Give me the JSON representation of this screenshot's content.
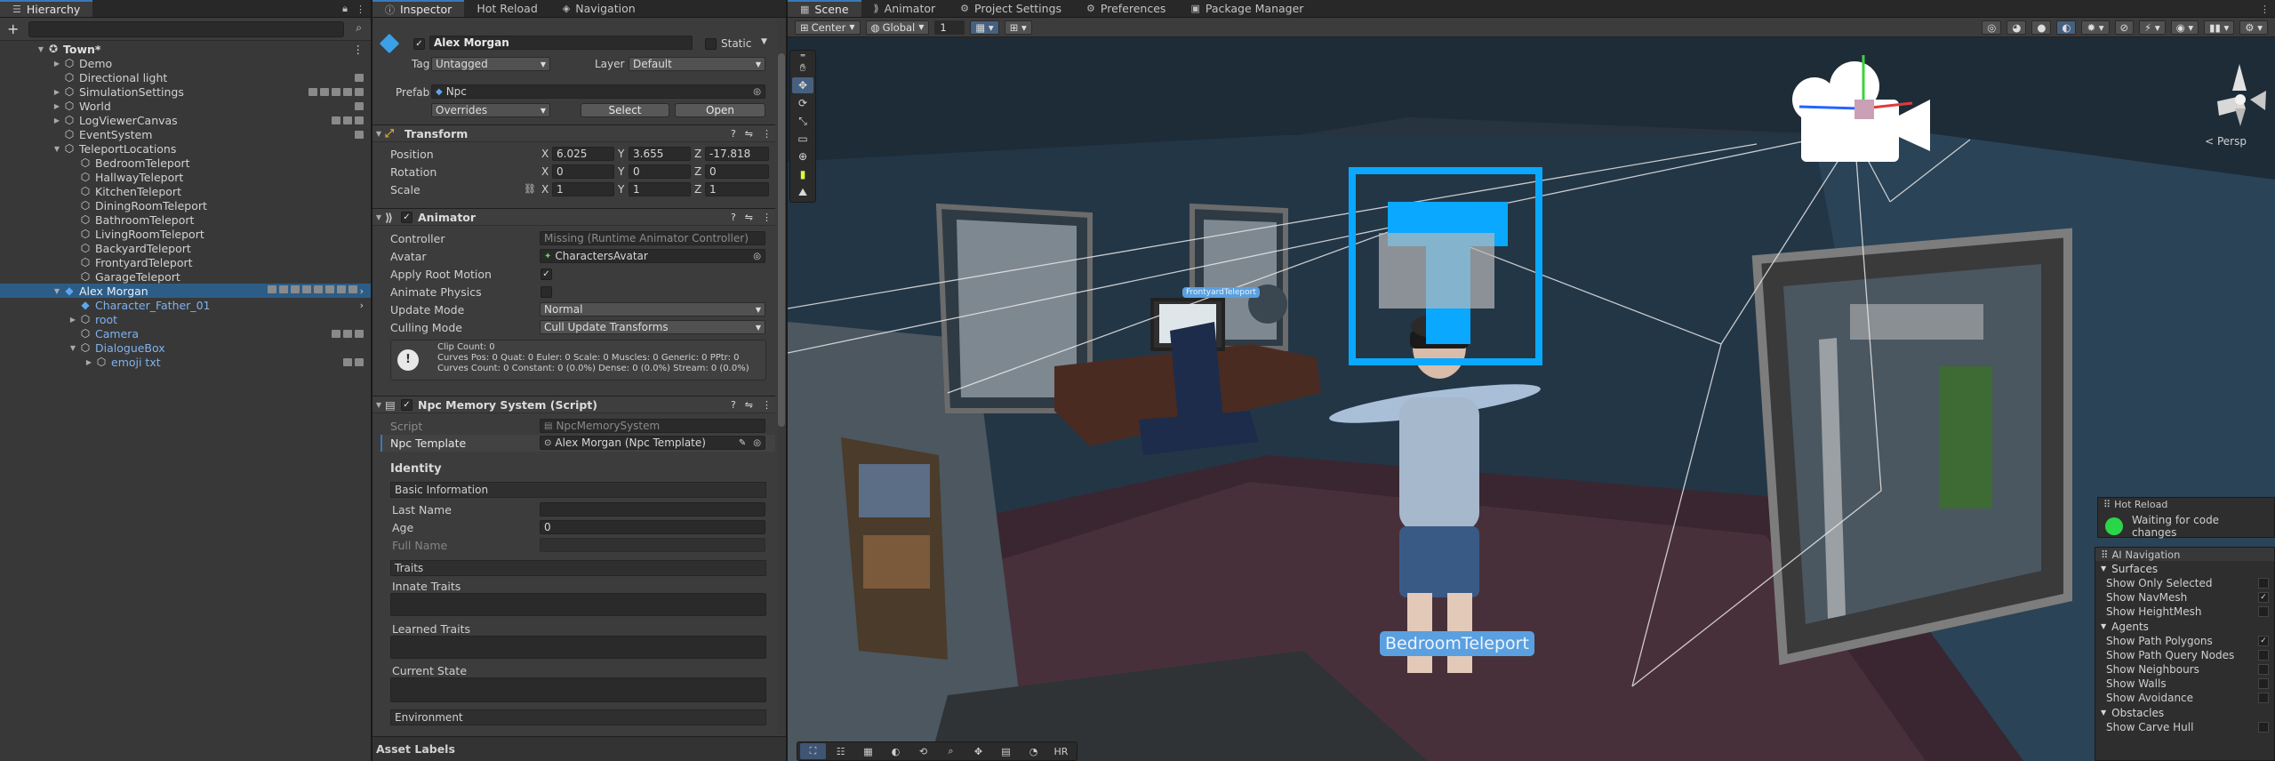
{
  "hierarchy": {
    "tab": "Hierarchy",
    "add_label": "+",
    "rows": [
      {
        "label": "Town*",
        "indent": 0,
        "arrow": "▼",
        "icon": "unity",
        "bold": true,
        "more": "⋮"
      },
      {
        "label": "Demo",
        "indent": 1,
        "arrow": "▶",
        "icon": "cube"
      },
      {
        "label": "Directional light",
        "indent": 1,
        "arrow": "",
        "icon": "cube",
        "badges": 1
      },
      {
        "label": "SimulationSettings",
        "indent": 1,
        "arrow": "▶",
        "icon": "cube",
        "badges": 5
      },
      {
        "label": "World",
        "indent": 1,
        "arrow": "▶",
        "icon": "cube",
        "badges": 1
      },
      {
        "label": "LogViewerCanvas",
        "indent": 1,
        "arrow": "▶",
        "icon": "cube",
        "badges": 3
      },
      {
        "label": "EventSystem",
        "indent": 1,
        "arrow": "",
        "icon": "cube",
        "badges": 1
      },
      {
        "label": "TeleportLocations",
        "indent": 1,
        "arrow": "▼",
        "icon": "cube"
      },
      {
        "label": "BedroomTeleport",
        "indent": 2,
        "arrow": "",
        "icon": "cube"
      },
      {
        "label": "HallwayTeleport",
        "indent": 2,
        "arrow": "",
        "icon": "cube"
      },
      {
        "label": "KitchenTeleport",
        "indent": 2,
        "arrow": "",
        "icon": "cube"
      },
      {
        "label": "DiningRoomTeleport",
        "indent": 2,
        "arrow": "",
        "icon": "cube"
      },
      {
        "label": "BathroomTeleport",
        "indent": 2,
        "arrow": "",
        "icon": "cube"
      },
      {
        "label": "LivingRoomTeleport",
        "indent": 2,
        "arrow": "",
        "icon": "cube"
      },
      {
        "label": "BackyardTeleport",
        "indent": 2,
        "arrow": "",
        "icon": "cube"
      },
      {
        "label": "FrontyardTeleport",
        "indent": 2,
        "arrow": "",
        "icon": "cube"
      },
      {
        "label": "GarageTeleport",
        "indent": 2,
        "arrow": "",
        "icon": "cube"
      },
      {
        "label": "Alex Morgan",
        "indent": 1,
        "arrow": "▼",
        "icon": "prefab",
        "selected": true,
        "blue": true,
        "badges": 8,
        "chev": "›"
      },
      {
        "label": "Character_Father_01",
        "indent": 2,
        "arrow": "",
        "icon": "prefab",
        "blue": true,
        "chev": "›"
      },
      {
        "label": "root",
        "indent": 2,
        "arrow": "▶",
        "icon": "cube",
        "blue": true
      },
      {
        "label": "Camera",
        "indent": 2,
        "arrow": "",
        "icon": "cube",
        "blue": true,
        "badges": 3
      },
      {
        "label": "DialogueBox",
        "indent": 2,
        "arrow": "▼",
        "icon": "cube",
        "blue": true
      },
      {
        "label": "emoji txt",
        "indent": 3,
        "arrow": "▶",
        "icon": "cube",
        "blue": true,
        "badges": 2
      }
    ]
  },
  "inspector": {
    "tabs": [
      "Inspector",
      "Hot Reload",
      "Navigation"
    ],
    "object_name": "Alex Morgan",
    "static_label": "Static",
    "tag_label": "Tag",
    "tag_value": "Untagged",
    "layer_label": "Layer",
    "layer_value": "Default",
    "prefab_label": "Prefab",
    "prefab_value": "Npc",
    "overrides_label": "Overrides",
    "select_label": "Select",
    "open_label": "Open",
    "transform": {
      "title": "Transform",
      "position_label": "Position",
      "rotation_label": "Rotation",
      "scale_label": "Scale",
      "position": [
        "6.025",
        "3.655",
        "-17.818"
      ],
      "rotation": [
        "0",
        "0",
        "0"
      ],
      "scale": [
        "1",
        "1",
        "1"
      ],
      "axis": [
        "X",
        "Y",
        "Z"
      ]
    },
    "animator": {
      "title": "Animator",
      "controller_label": "Controller",
      "controller_value": "Missing (Runtime Animator Controller)",
      "avatar_label": "Avatar",
      "avatar_value": "CharactersAvatar",
      "apply_root_label": "Apply Root Motion",
      "animate_physics_label": "Animate Physics",
      "update_mode_label": "Update Mode",
      "update_mode_value": "Normal",
      "culling_label": "Culling Mode",
      "culling_value": "Cull Update Transforms",
      "info_lines": [
        "Clip Count: 0",
        "Curves Pos: 0 Quat: 0 Euler: 0 Scale: 0 Muscles: 0 Generic: 0 PPtr: 0",
        "Curves Count: 0 Constant: 0 (0.0%) Dense: 0 (0.0%) Stream: 0 (0.0%)"
      ]
    },
    "memory": {
      "title": "Npc Memory System (Script)",
      "script_label": "Script",
      "script_value": "NpcMemorySystem",
      "template_label": "Npc Template",
      "template_value": "Alex Morgan (Npc Template)",
      "identity": "Identity",
      "basic_info": "Basic Information",
      "last_name_label": "Last Name",
      "age_label": "Age",
      "age_value": "0",
      "full_name_label": "Full Name",
      "traits": "Traits",
      "innate_label": "Innate Traits",
      "learned_label": "Learned Traits",
      "current_label": "Current State",
      "environment": "Environment"
    },
    "asset_labels": "Asset Labels"
  },
  "scene": {
    "tabs": [
      "Scene",
      "Animator",
      "Project Settings",
      "Preferences",
      "Package Manager"
    ],
    "pivot": "Center",
    "space": "Global",
    "snap_value": "1",
    "persp_label": "< Persp",
    "labels": {
      "bedroom": "BedroomTeleport",
      "frontyard": "FrontyardTeleport"
    },
    "bottom_tools": [
      "⛶",
      "☷",
      "▦",
      "◐",
      "⟲",
      "⌕",
      "✥",
      "▤",
      "◔",
      "HR"
    ],
    "hot_reload": {
      "title": "Hot Reload",
      "status": "Waiting for code changes",
      "status_color": "#2bd54a"
    },
    "ai_nav": {
      "title": "AI Navigation",
      "groups": [
        {
          "name": "Surfaces",
          "items": [
            {
              "label": "Show Only Selected",
              "checked": false
            },
            {
              "label": "Show NavMesh",
              "checked": true
            },
            {
              "label": "Show HeightMesh",
              "checked": false
            }
          ]
        },
        {
          "name": "Agents",
          "items": [
            {
              "label": "Show Path Polygons",
              "checked": true
            },
            {
              "label": "Show Path Query Nodes",
              "checked": false
            },
            {
              "label": "Show Neighbours",
              "checked": false
            },
            {
              "label": "Show Walls",
              "checked": false
            },
            {
              "label": "Show Avoidance",
              "checked": false
            }
          ]
        },
        {
          "name": "Obstacles",
          "items": [
            {
              "label": "Show Carve Hull",
              "checked": false
            }
          ]
        }
      ]
    }
  },
  "colors": {
    "accent": "#3a79bb",
    "selection": "#2c5d87",
    "prefab_text": "#7fb2ee",
    "gizmo_cyan": "#0aa8ff"
  }
}
